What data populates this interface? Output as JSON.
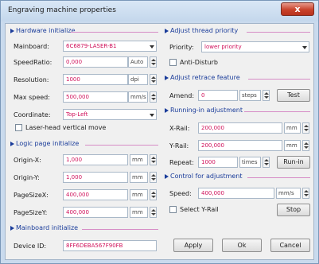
{
  "window": {
    "title": "Engraving machine properties",
    "close_label": "x"
  },
  "hardware": {
    "title": "Hardware initialize",
    "mainboard": {
      "label": "Mainboard:",
      "value": "6C6879-LASER-B1"
    },
    "speed_ratio": {
      "label": "SpeedRatio:",
      "value": "0,000",
      "unit": "Auto"
    },
    "resolution": {
      "label": "Resolution:",
      "value": "1000",
      "unit": "dpi"
    },
    "max_speed": {
      "label": "Max speed:",
      "value": "500,000",
      "unit": "mm/s"
    },
    "coordinate": {
      "label": "Coordinate:",
      "value": "Top-Left"
    },
    "vertical_move": {
      "label": "Laser-head vertical move"
    }
  },
  "logic_page": {
    "title": "Logic page initialize",
    "origin_x": {
      "label": "Origin-X:",
      "value": "1,000",
      "unit": "mm"
    },
    "origin_y": {
      "label": "Origin-Y:",
      "value": "1,000",
      "unit": "mm"
    },
    "page_size_x": {
      "label": "PageSizeX:",
      "value": "400,000",
      "unit": "mm"
    },
    "page_size_y": {
      "label": "PageSizeY:",
      "value": "400,000",
      "unit": "mm"
    }
  },
  "mainboard_init": {
    "title": "Mainboard initialize",
    "device_id": {
      "label": "Device ID:",
      "value": "8FF6DEBA567F90FB"
    }
  },
  "thread_priority": {
    "title": "Adjust thread priority",
    "priority": {
      "label": "Priority:",
      "value": "lower priority"
    },
    "anti_disturb": {
      "label": "Anti-Disturb"
    }
  },
  "retrace": {
    "title": "Adjust retrace feature",
    "amend": {
      "label": "Amend:",
      "value": "0",
      "unit": "steps"
    },
    "test_label": "Test"
  },
  "running_in": {
    "title": "Running-in adjustment",
    "x_rail": {
      "label": "X-Rail:",
      "value": "200,000",
      "unit": "mm"
    },
    "y_rail": {
      "label": "Y-Rail:",
      "value": "200,000",
      "unit": "mm"
    },
    "repeat": {
      "label": "Repeat:",
      "value": "1000",
      "unit": "times"
    },
    "run_in_label": "Run-in"
  },
  "control": {
    "title": "Control for adjustment",
    "speed": {
      "label": "Speed:",
      "value": "400,000",
      "unit": "mm/s"
    },
    "select_y_rail": {
      "label": "Select Y-Rail"
    },
    "stop_label": "Stop"
  },
  "footer": {
    "apply_label": "Apply",
    "ok_label": "Ok",
    "cancel_label": "Cancel"
  },
  "colors": {
    "accent": "#1a3c9a",
    "value_text": "#d0105a",
    "group_line": "#d68cc6"
  }
}
